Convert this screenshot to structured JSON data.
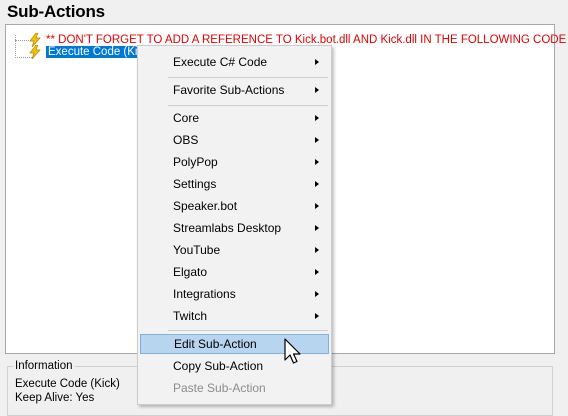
{
  "panel_title": "Sub-Actions",
  "tree": {
    "items": [
      {
        "text": "** DON'T FORGET TO ADD A REFERENCE TO Kick.bot.dll AND Kick.dll IN THE FOLLOWING CODE **",
        "icon": "lightning-bolt-icon"
      },
      {
        "text": "Execute Code (Kick)",
        "icon": "lightning-bolt-icon",
        "selected": true
      }
    ]
  },
  "info": {
    "label": "Information",
    "lines": [
      "Execute Code (Kick)",
      "Keep Alive: Yes"
    ]
  },
  "context_menu": {
    "items": [
      {
        "label": "Execute C# Code",
        "submenu": true
      },
      {
        "label": "Favorite Sub-Actions",
        "submenu": true
      },
      {
        "label": "Core",
        "submenu": true
      },
      {
        "label": "OBS",
        "submenu": true
      },
      {
        "label": "PolyPop",
        "submenu": true
      },
      {
        "label": "Settings",
        "submenu": true
      },
      {
        "label": "Speaker.bot",
        "submenu": true
      },
      {
        "label": "Streamlabs Desktop",
        "submenu": true
      },
      {
        "label": "YouTube",
        "submenu": true
      },
      {
        "label": "Elgato",
        "submenu": true
      },
      {
        "label": "Integrations",
        "submenu": true
      },
      {
        "label": "Twitch",
        "submenu": true
      },
      {
        "label": "Edit Sub-Action",
        "highlighted": true
      },
      {
        "label": "Copy Sub-Action"
      },
      {
        "label": "Paste Sub-Action",
        "disabled": true
      }
    ]
  },
  "colors": {
    "selection": "#0078d7",
    "warning_text": "#e30000",
    "menu_highlight": "#b8d5f0",
    "bolt": "#f5c400"
  }
}
